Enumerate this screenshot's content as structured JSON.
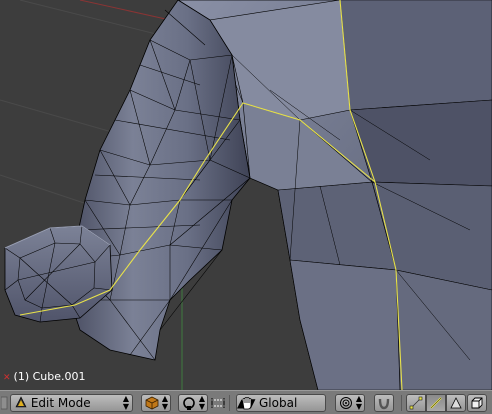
{
  "viewport": {
    "object_label": "(1) Cube.001"
  },
  "header": {
    "mode_menu": {
      "label": "Edit Mode",
      "icon": "edit-mode-triangle-icon"
    },
    "orientation_menu": {
      "label": "Global"
    },
    "icons": [
      "editmode-mesh-icon",
      "pivot-icon",
      "manipulator-toggle-icon",
      "hand-grab-icon",
      "proportional-edit-icon",
      "snap-magnet-icon",
      "vertex-select-icon",
      "edge-select-icon",
      "face-select-icon",
      "occlude-geometry-icon"
    ],
    "edge_select_active": true
  },
  "colors": {
    "mesh_face": "#6a7086",
    "mesh_wire": "#000000",
    "seam_edge": "#e8e24a",
    "background": "#3d3d3d",
    "header": "#7a7a7a"
  }
}
